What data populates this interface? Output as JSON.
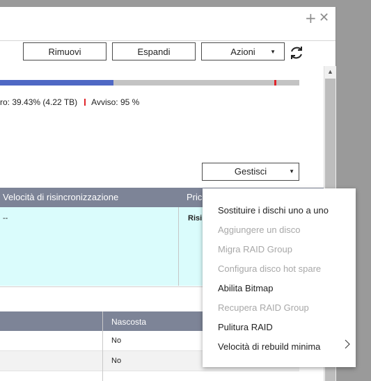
{
  "titlebar": {
    "add_icon": "plus-icon",
    "close_icon": "close-icon"
  },
  "toolbar": {
    "remove_label": "Rimuovi",
    "expand_label": "Espandi",
    "actions_label": "Azioni",
    "refresh_icon": "refresh-icon"
  },
  "capacity": {
    "used_fraction": 0.3943,
    "warning_fraction": 0.95,
    "used_text": "ro: 39.43% (4.22 TB)",
    "warning_text": "Avviso: 95 %",
    "used_color": "#4f68c4",
    "warning_color": "#e0252b"
  },
  "manage": {
    "label": "Gestisci"
  },
  "table1": {
    "columns": [
      "Velocità di risincronizzazione",
      "Pric"
    ],
    "row": [
      "--",
      "Risi"
    ]
  },
  "table2": {
    "columns": [
      "",
      "Nascosta"
    ],
    "rows": [
      [
        "",
        "No"
      ],
      [
        "",
        "No"
      ]
    ]
  },
  "menu": {
    "items": [
      {
        "label": "Sostituire i dischi uno a uno",
        "enabled": true
      },
      {
        "label": "Aggiungere un disco",
        "enabled": false
      },
      {
        "label": "Migra RAID Group",
        "enabled": false
      },
      {
        "label": "Configura disco hot spare",
        "enabled": false
      },
      {
        "label": "Abilita Bitmap",
        "enabled": true
      },
      {
        "label": "Recupera RAID Group",
        "enabled": false
      },
      {
        "label": "Pulitura RAID",
        "enabled": true
      },
      {
        "label": "Velocità di rebuild minima",
        "enabled": true
      }
    ]
  }
}
